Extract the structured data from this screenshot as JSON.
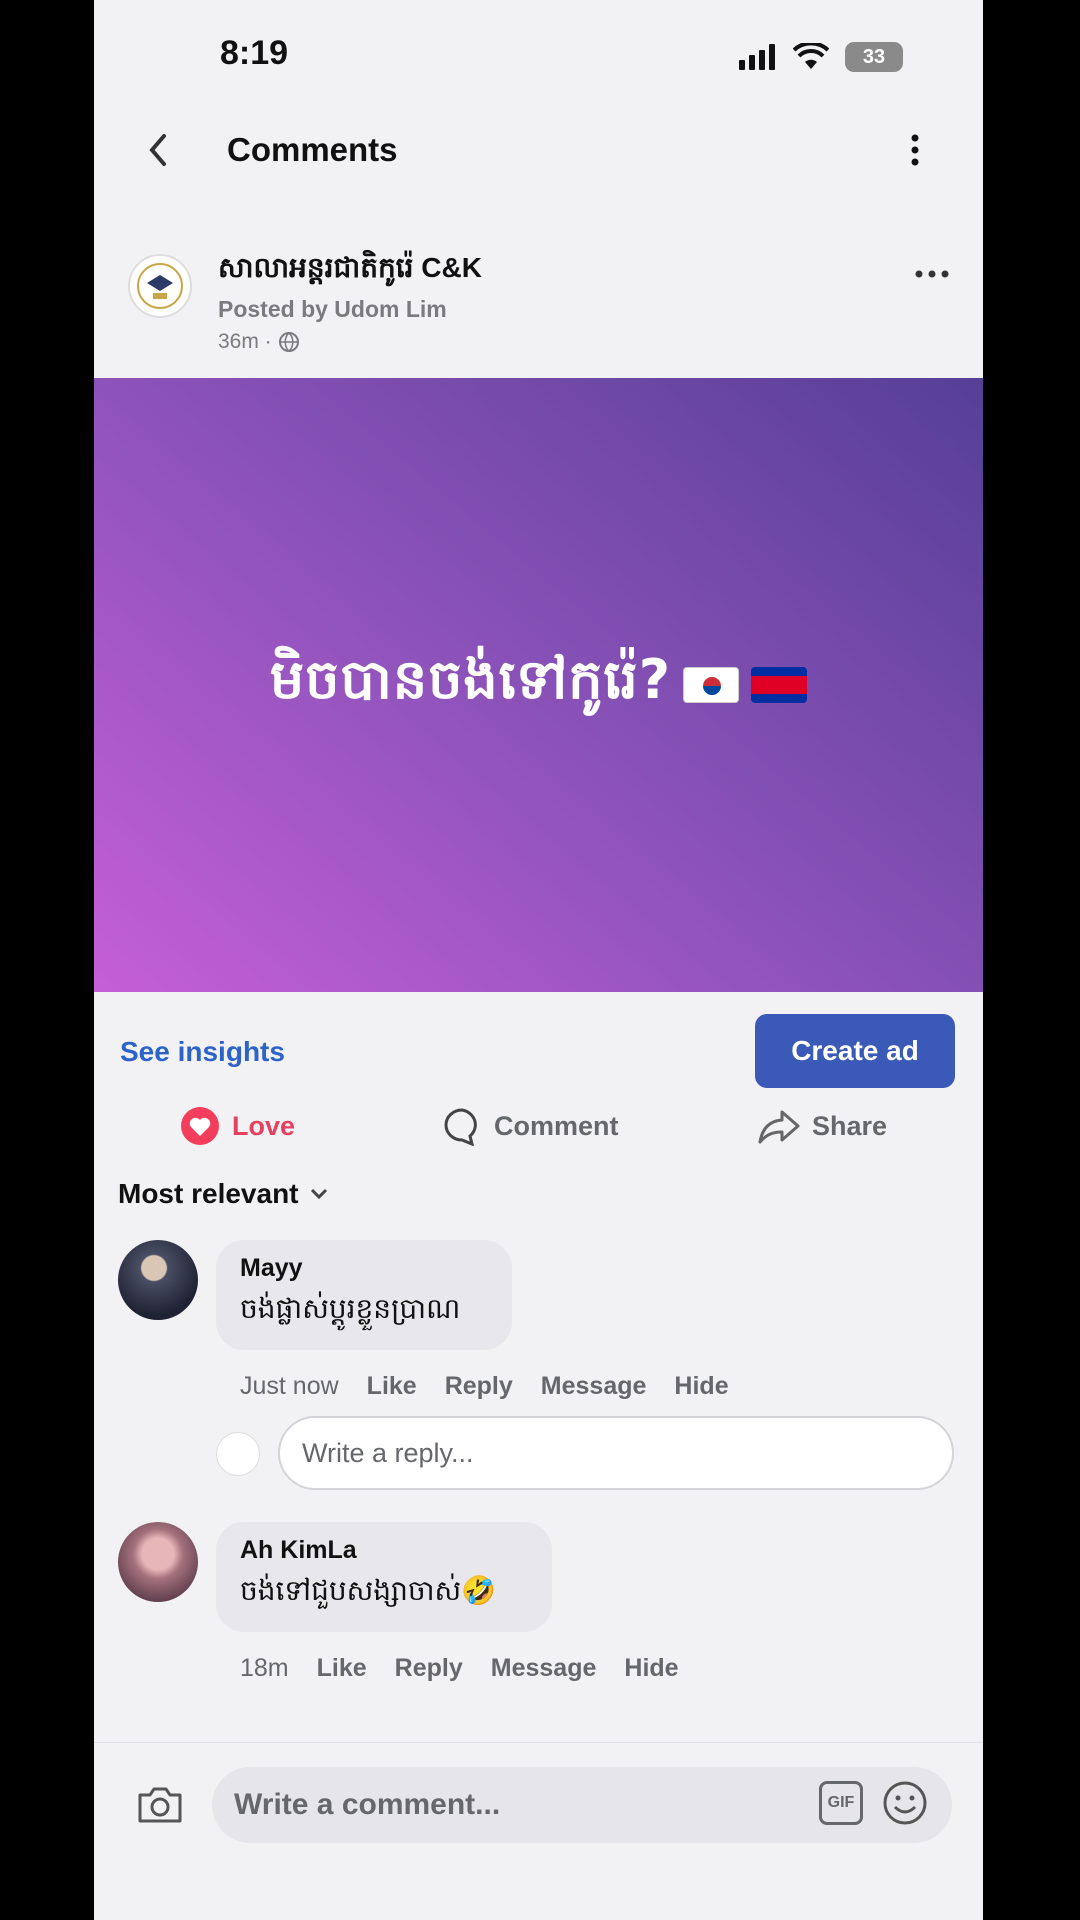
{
  "status_bar": {
    "time": "8:19",
    "battery": "33"
  },
  "header": {
    "title": "Comments"
  },
  "post": {
    "page_name": "សាលាអន្តរជាតិកូរ៉េ C&K",
    "posted_by": "Posted by Udom Lim",
    "time": "36m ·",
    "image_text": "មិចបានចង់ទៅកូរ៉េ?"
  },
  "actions": {
    "see_insights": "See insights",
    "create_ad": "Create ad",
    "love": "Love",
    "comment": "Comment",
    "share": "Share"
  },
  "sort": {
    "label": "Most relevant"
  },
  "comments": [
    {
      "name": "Mayy",
      "text": "ចង់ផ្លាស់ប្តូរខ្លួនប្រាណ",
      "time": "Just now",
      "like": "Like",
      "reply": "Reply",
      "message": "Message",
      "hide": "Hide"
    },
    {
      "name": "Ah KimLa",
      "text": "ចង់ទៅជួបសង្សាចាស់🤣",
      "time": "18m",
      "like": "Like",
      "reply": "Reply",
      "message": "Message",
      "hide": "Hide"
    }
  ],
  "reply_box": {
    "placeholder": "Write a reply..."
  },
  "comment_bar": {
    "placeholder": "Write a comment...",
    "gif": "GIF"
  },
  "colors": {
    "accent": "#3b5ab8",
    "link": "#2d63c8",
    "love": "#e4405f"
  }
}
